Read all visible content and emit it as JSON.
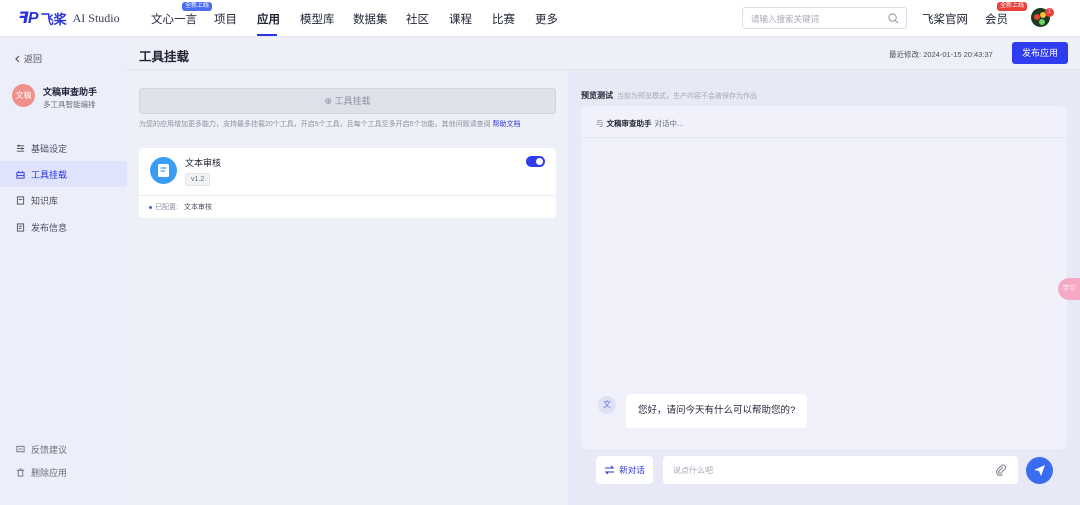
{
  "brand": {
    "mark": "ꟻP",
    "name_cn": "飞桨",
    "name_en": "AI Studio"
  },
  "nav": {
    "items": [
      "文心一言",
      "项目",
      "应用",
      "模型库",
      "数据集",
      "社区",
      "课程",
      "比赛",
      "更多"
    ],
    "active": "应用",
    "new_badge": "全新上线",
    "search_placeholder": "请输入搜索关键词",
    "official_site": "飞桨官网",
    "member": "会员",
    "member_badge": "全新上线",
    "notification_count": "1"
  },
  "sidebar": {
    "back": "返回",
    "app_avatar_text": "文稿",
    "app_name": "文稿审查助手",
    "app_desc": "多工具智能编排",
    "items": [
      {
        "label": "基础设定",
        "icon": "sliders-icon"
      },
      {
        "label": "工具挂载",
        "icon": "tool-icon"
      },
      {
        "label": "知识库",
        "icon": "book-icon"
      },
      {
        "label": "发布信息",
        "icon": "publish-icon"
      }
    ],
    "active": "工具挂载",
    "bottom": [
      {
        "label": "反馈建议",
        "icon": "feedback-icon"
      },
      {
        "label": "删除应用",
        "icon": "trash-icon"
      }
    ]
  },
  "header": {
    "title": "工具挂载",
    "last_modified_label": "最近修改:",
    "last_modified_value": "2024-01-15 20:43:37",
    "publish_button": "发布应用"
  },
  "tools": {
    "mount_button": "⊕ 工具挂载",
    "hint": "为您的应用增加更多能力，支持最多挂载20个工具，开启5个工具，且每个工具至多开启5个功能，其他问题请查阅",
    "hint_link": "帮助文档",
    "card": {
      "name": "文本审核",
      "version": "v1.2",
      "enabled": true,
      "config_label": "已配置:",
      "config_value": "文本审核"
    }
  },
  "preview": {
    "title": "预览测试",
    "subtitle": "当前为预览模式，生产内容不会被保存为作品",
    "chat_with_prefix": "与",
    "chat_with_name": "文稿审查助手",
    "chat_with_suffix": "对话中...",
    "bot_avatar": "文",
    "greeting": "您好，请问今天有什么可以帮助您的?",
    "new_chat": "新对话",
    "input_placeholder": "说点什么吧",
    "float_tab": "学习"
  },
  "colors": {
    "accent": "#2932e1",
    "button": "#2f3cf0",
    "badge_red": "#e8423b"
  }
}
